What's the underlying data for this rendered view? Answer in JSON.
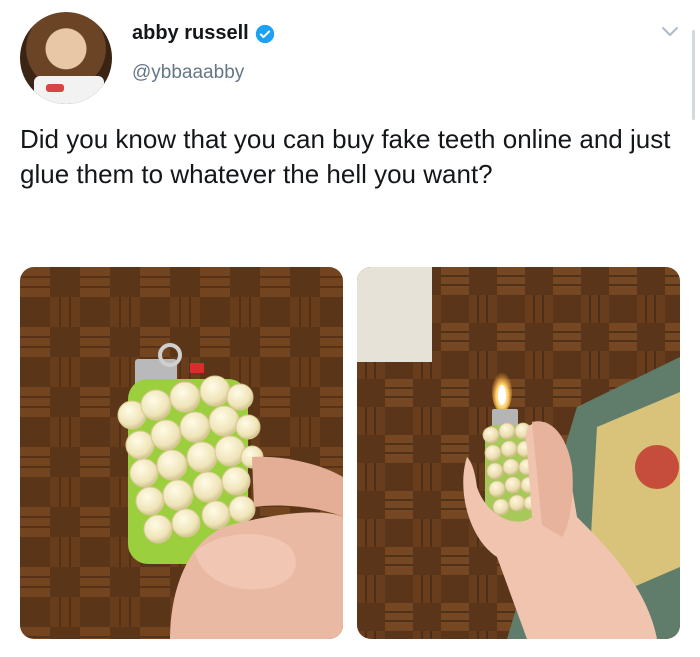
{
  "tweet": {
    "display_name": "abby russell",
    "handle": "@ybbaaabby",
    "verified": true,
    "text": "Did you know that you can buy fake teeth online and just glue them to whatever the hell you want?",
    "caret_icon": "chevron-down-icon"
  },
  "colors": {
    "verified_blue": "#1da1f2",
    "handle_gray": "#657786",
    "text_dark": "#14171a"
  },
  "media": [
    {
      "subject": "lighter covered in fake teeth held in hand"
    },
    {
      "subject": "lit lighter covered in fake teeth held in hand"
    }
  ]
}
